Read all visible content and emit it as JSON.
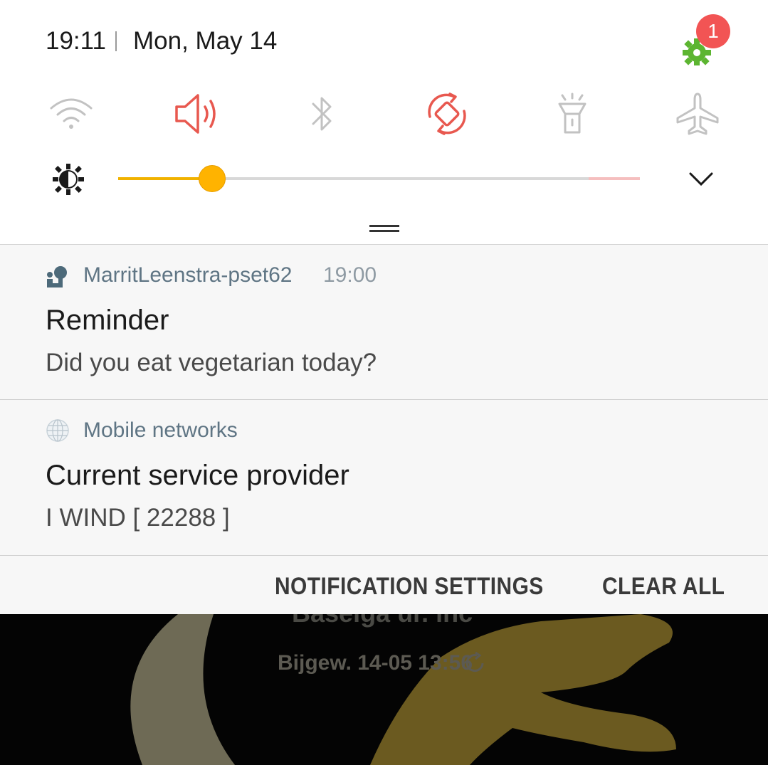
{
  "status": {
    "time": "19:11",
    "date": "Mon, May 14",
    "badge_count": "1"
  },
  "quick_settings": [
    {
      "name": "wifi-icon",
      "active": false
    },
    {
      "name": "sound-icon",
      "active": true
    },
    {
      "name": "bluetooth-icon",
      "active": false
    },
    {
      "name": "auto-rotate-icon",
      "active": true
    },
    {
      "name": "flashlight-icon",
      "active": false
    },
    {
      "name": "airplane-mode-icon",
      "active": false
    }
  ],
  "brightness": {
    "level": 0.18
  },
  "notifications": [
    {
      "app": "MarritLeenstra-pset62",
      "time": "19:00",
      "title": "Reminder",
      "body": "Did you eat vegetarian today?"
    },
    {
      "app": "Mobile networks",
      "title": "Current service provider",
      "body": "I WIND [ 22288 ]"
    }
  ],
  "actions": {
    "settings_label": "NOTIFICATION SETTINGS",
    "clear_label": "CLEAR ALL"
  },
  "wallpaper": {
    "top_text": "Baseiga ur. inc",
    "updated_text": "Bijgew. 14-05 13:56"
  },
  "colors": {
    "accent_red": "#e8584f",
    "slider": "#ffb300",
    "inactive": "#bdbdbd",
    "gear": "#5cb531"
  }
}
